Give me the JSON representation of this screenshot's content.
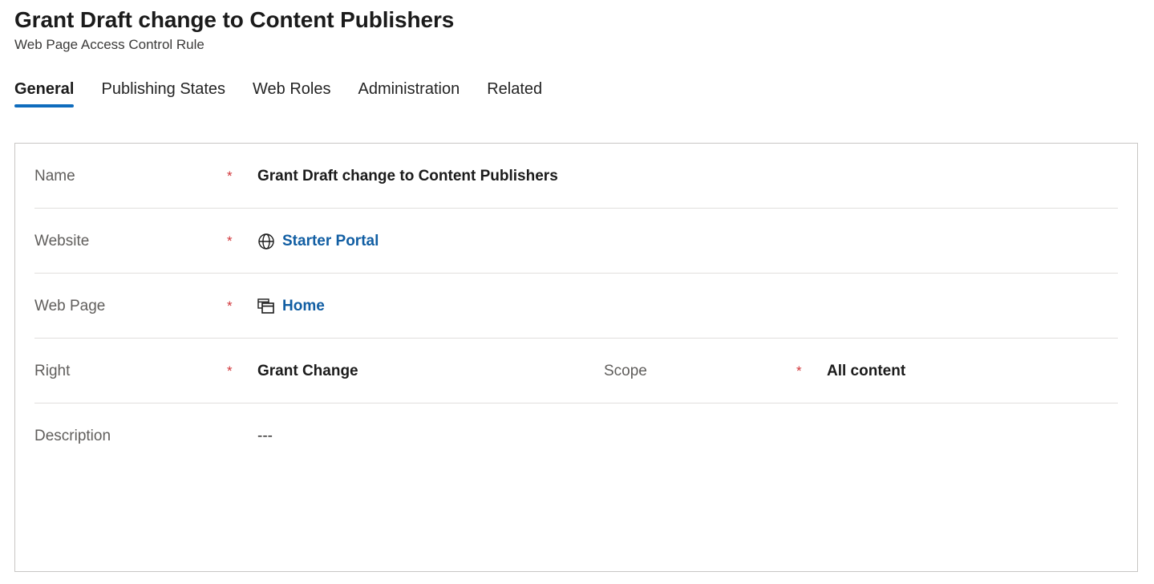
{
  "header": {
    "title": "Grant Draft change to Content Publishers",
    "subtitle": "Web Page Access Control Rule"
  },
  "tabs": [
    {
      "label": "General",
      "selected": true
    },
    {
      "label": "Publishing States",
      "selected": false
    },
    {
      "label": "Web Roles",
      "selected": false
    },
    {
      "label": "Administration",
      "selected": false
    },
    {
      "label": "Related",
      "selected": false
    }
  ],
  "form": {
    "rows": [
      {
        "left": {
          "label": "Name",
          "required": "*",
          "value": "Grant Draft change to Content Publishers",
          "icon": null,
          "style": "bold"
        },
        "right": null
      },
      {
        "left": {
          "label": "Website",
          "required": "*",
          "value": "Starter Portal",
          "icon": "globe-icon",
          "style": "link"
        },
        "right": null
      },
      {
        "left": {
          "label": "Web Page",
          "required": "*",
          "value": "Home",
          "icon": "web-page-icon",
          "style": "link"
        },
        "right": null
      },
      {
        "left": {
          "label": "Right",
          "required": "*",
          "value": "Grant Change",
          "icon": null,
          "style": "bold"
        },
        "right": {
          "label": "Scope",
          "required": "*",
          "value": "All content",
          "icon": null,
          "style": "bold"
        }
      },
      {
        "left": {
          "label": "Description",
          "required": "",
          "value": "---",
          "icon": null,
          "style": "normal"
        },
        "right": null
      }
    ]
  },
  "colors": {
    "accent": "#0f6cbd",
    "link": "#115ea3",
    "required": "#d13438",
    "border": "#c8c6c4",
    "divider": "#e1dfdd",
    "label": "#605e5c",
    "text": "#1b1b1b"
  }
}
